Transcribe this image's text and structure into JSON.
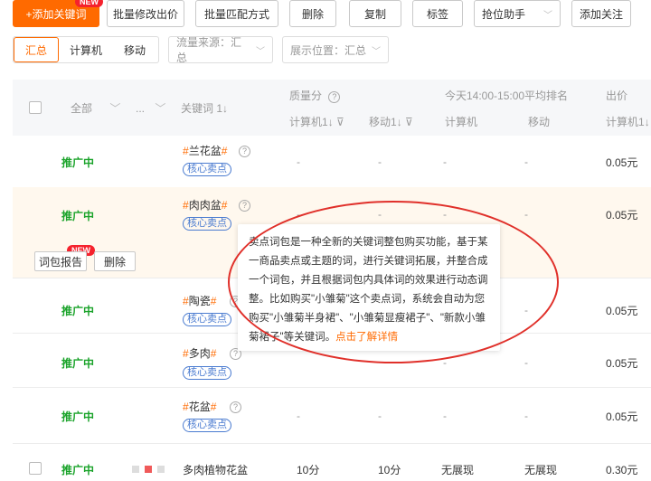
{
  "toolbar": {
    "add_keyword": "+添加关键词",
    "new_badge": "NEW",
    "batch_price": "批量修改出价",
    "batch_match": "批量匹配方式",
    "delete": "删除",
    "copy": "复制",
    "tag": "标签",
    "rank_helper": "抢位助手",
    "add_follow": "添加关注"
  },
  "filters": {
    "device_tabs": [
      "汇总",
      "计算机",
      "移动"
    ],
    "traffic_source": "流量来源：汇总",
    "display_position": "展示位置：汇总"
  },
  "table": {
    "header": {
      "all": "全部",
      "more": "...",
      "keyword": "关键词",
      "sort_icon": "1↓",
      "quality_score": "质量分",
      "quality_pc": "计算机",
      "quality_mobile": "移动",
      "avg_rank": "今天14:00-15:00平均排名",
      "rank_pc": "计算机",
      "rank_mobile": "移动",
      "bid": "出价",
      "bid_pc": "计算机"
    },
    "rows": [
      {
        "status": "推广中",
        "keyword": "兰花盆",
        "tag": "核心卖点",
        "q_pc": "-",
        "q_mobile": "-",
        "r_pc": "-",
        "r_mobile": "-",
        "price": "0.05元"
      },
      {
        "status": "推广中",
        "keyword": "肉肉盆",
        "tag": "核心卖点",
        "q_pc": "-",
        "q_mobile": "-",
        "r_pc": "-",
        "r_mobile": "-",
        "price": "0.05元"
      },
      {
        "status": "推广中",
        "keyword": "陶瓷",
        "tag": "核心卖点",
        "q_pc": "-",
        "q_mobile": "-",
        "r_pc": "-",
        "r_mobile": "-",
        "price": "0.05元"
      },
      {
        "status": "推广中",
        "keyword": "多肉",
        "tag": "核心卖点",
        "q_pc": "-",
        "q_mobile": "-",
        "r_pc": "-",
        "r_mobile": "-",
        "price": "0.05元"
      },
      {
        "status": "推广中",
        "keyword": "花盆",
        "tag": "核心卖点",
        "q_pc": "-",
        "q_mobile": "-",
        "r_pc": "-",
        "r_mobile": "-",
        "price": "0.05元"
      },
      {
        "status": "推广中",
        "keyword": "多肉植物花盆",
        "tag": "",
        "q_pc": "10分",
        "q_mobile": "10分",
        "r_pc": "无展现",
        "r_mobile": "无展现",
        "price": "0.30元"
      }
    ],
    "row_actions": {
      "report": "词包报告",
      "delete": "删除",
      "new_badge": "NEW"
    }
  },
  "tooltip": {
    "text": "卖点词包是一种全新的关键词整包购买功能，基于某一商品卖点或主题的词，进行关键词拓展，并整合成一个词包，并且根据词包内具体词的效果进行动态调整。比如购买\"小雏菊\"这个卖点词，系统会自动为您购买\"小雏菊半身裙\"、\"小雏菊显瘦裙子\"、\"新款小雏菊裙子\"等关键词。",
    "link": "点击了解详情"
  },
  "colors": {
    "accent": "#ff6a00",
    "status_green": "#1aa32a",
    "tag_blue": "#4a7bd0",
    "annotation_red": "#e0302a"
  }
}
